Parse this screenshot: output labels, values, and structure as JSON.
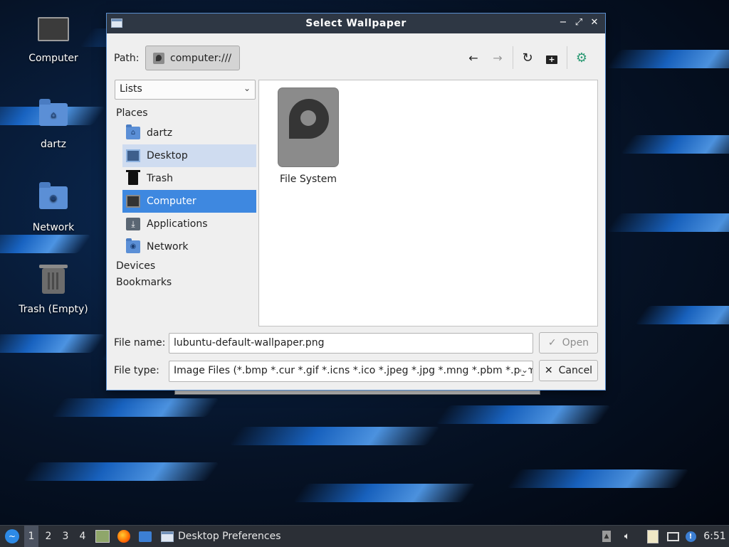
{
  "desktop": {
    "icons": [
      {
        "label": "Computer",
        "icon": "computer-icon"
      },
      {
        "label": "dartz",
        "icon": "home-folder-icon"
      },
      {
        "label": "Network",
        "icon": "network-folder-icon"
      },
      {
        "label": "Trash (Empty)",
        "icon": "trash-icon"
      }
    ]
  },
  "dialog": {
    "title": "Select Wallpaper",
    "titlebar_buttons": {
      "minimize": "−",
      "maximize": "⤢",
      "close": "✕"
    },
    "path_label": "Path:",
    "path_value": "computer:///",
    "toolbar": {
      "back": "←",
      "forward": "→",
      "reload": "↻",
      "new_folder": "+",
      "extra": "⚙"
    },
    "view_mode": "Lists",
    "sidebar": {
      "places_heading": "Places",
      "places": [
        {
          "label": "dartz",
          "icon": "home-folder-icon"
        },
        {
          "label": "Desktop",
          "icon": "desktop-icon"
        },
        {
          "label": "Trash",
          "icon": "trash-icon"
        },
        {
          "label": "Computer",
          "icon": "computer-icon"
        },
        {
          "label": "Applications",
          "icon": "applications-icon"
        },
        {
          "label": "Network",
          "icon": "network-folder-icon"
        }
      ],
      "devices_heading": "Devices",
      "bookmarks_heading": "Bookmarks"
    },
    "files": [
      {
        "label": "File System",
        "icon": "drive-icon"
      }
    ],
    "file_name_label": "File name:",
    "file_name_value": "lubuntu-default-wallpaper.png",
    "file_type_label": "File type:",
    "file_type_value": "Image Files (*.bmp *.cur *.gif *.icns *.ico *.jpeg *.jpg *.mng *.pbm *.pgm",
    "open_label": "Open",
    "cancel_label": "Cancel"
  },
  "taskbar": {
    "workspaces": [
      "1",
      "2",
      "3",
      "4"
    ],
    "active_workspace": "1",
    "task_label": "Desktop Preferences",
    "clock": "6:51"
  },
  "colors": {
    "titlebar": "#2e3744",
    "selection": "#3e88e0",
    "hover": "#cfdcf0",
    "taskbar": "#2b2f36",
    "folder": "#5b8fd6"
  }
}
